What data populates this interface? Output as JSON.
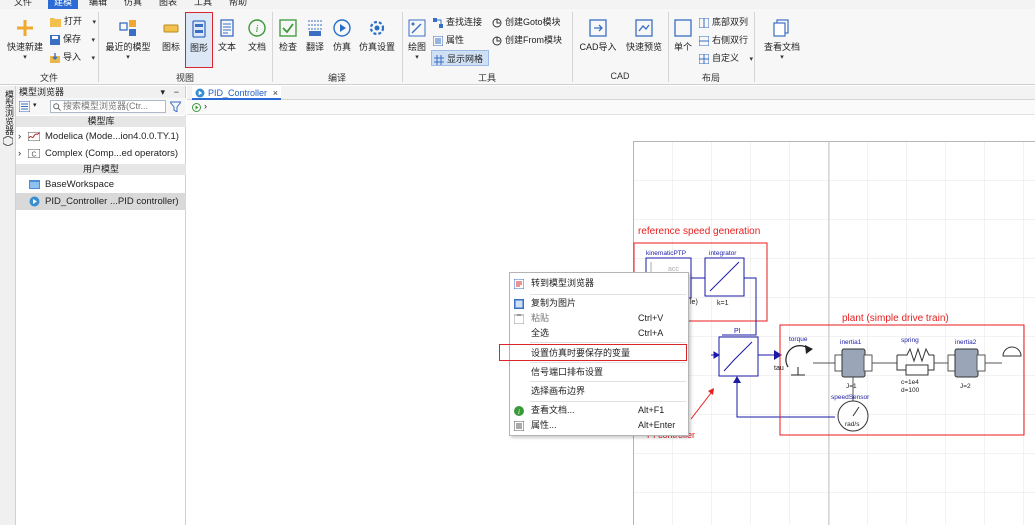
{
  "menubar": {
    "items": [
      "文件",
      "建模",
      "编辑",
      "仿真",
      "图表",
      "工具",
      "帮助"
    ]
  },
  "ribbon": {
    "file_group": {
      "quick_new": "快速新建",
      "open": "打开",
      "save": "保存",
      "import": "导入",
      "label": "文件"
    },
    "view_group": {
      "recent_models": "最近的模型",
      "icon": "图标",
      "diagram": "图形",
      "text": "文本",
      "doc": "文档",
      "label": "视图"
    },
    "compile_group": {
      "check": "检查",
      "translate": "翻译",
      "simulate": "仿真",
      "sim_settings": "仿真设置",
      "label": "编译"
    },
    "tools_group": {
      "draw": "绘图",
      "find_connect": "查找连接",
      "properties": "属性",
      "show_grid": "显示网格",
      "create_goto": "创建Goto模块",
      "create_from": "创建From模块",
      "label": "工具"
    },
    "cad_group": {
      "cad_import": "CAD导入",
      "quick_preview": "快速预览",
      "label": "CAD"
    },
    "layout_group": {
      "single": "单个",
      "bottom_dual": "底部双列",
      "right_dual": "右侧双行",
      "custom": "自定义",
      "label": "布局"
    },
    "view_docs": "查看文档"
  },
  "sidestrip": {
    "label": "模型浏览器"
  },
  "browser": {
    "title": "模型浏览器",
    "search_placeholder": "搜索模型浏览器(Ctr...",
    "section_lib": "模型库",
    "lib_items": [
      "Modelica (Mode...ion4.0.0.TY.1)",
      "Complex (Comp...ed operators)"
    ],
    "section_user": "用户模型",
    "user_items": [
      "BaseWorkspace",
      "PID_Controller ...PID controller)"
    ]
  },
  "tab": {
    "label": "PID_Controller",
    "close": "×"
  },
  "diagram": {
    "ref_title": "reference speed generation",
    "plant_title": "plant (simple drive train)",
    "kinematic": "kinematicPTP",
    "kinematic_acc": "acc",
    "kinematic_partial": "le)",
    "integrator": "integrator",
    "integrator_k": "k=1",
    "pi": "PI",
    "torque": "torque",
    "tau": "tau",
    "inertia1": "inertia1",
    "inertia1_j": "J=1",
    "spring": "spring",
    "spring_c": "c=1e4",
    "spring_d": "d=100",
    "inertia2": "inertia2",
    "inertia2_j": "J=2",
    "speed_sensor": "speedSensor",
    "rad_s": "rad/s",
    "pi_controller": "PI controller"
  },
  "context_menu": {
    "items": [
      {
        "label": "转到模型浏览器",
        "shortcut": ""
      },
      {
        "label": "复制为图片",
        "shortcut": ""
      },
      {
        "label": "粘贴",
        "shortcut": "Ctrl+V"
      },
      {
        "label": "全选",
        "shortcut": "Ctrl+A"
      },
      {
        "label": "设置仿真时要保存的变量",
        "shortcut": ""
      },
      {
        "label": "信号端口排布设置",
        "shortcut": ""
      },
      {
        "label": "选择画布边界",
        "shortcut": ""
      },
      {
        "label": "查看文档...",
        "shortcut": "Alt+F1"
      },
      {
        "label": "属性...",
        "shortcut": "Alt+Enter"
      }
    ]
  },
  "colors": {
    "accent": "#2b6bd6",
    "highlight_red": "#d9262b",
    "diagram_blue": "#1a1aa6",
    "diagram_red": "#e81e1e"
  }
}
